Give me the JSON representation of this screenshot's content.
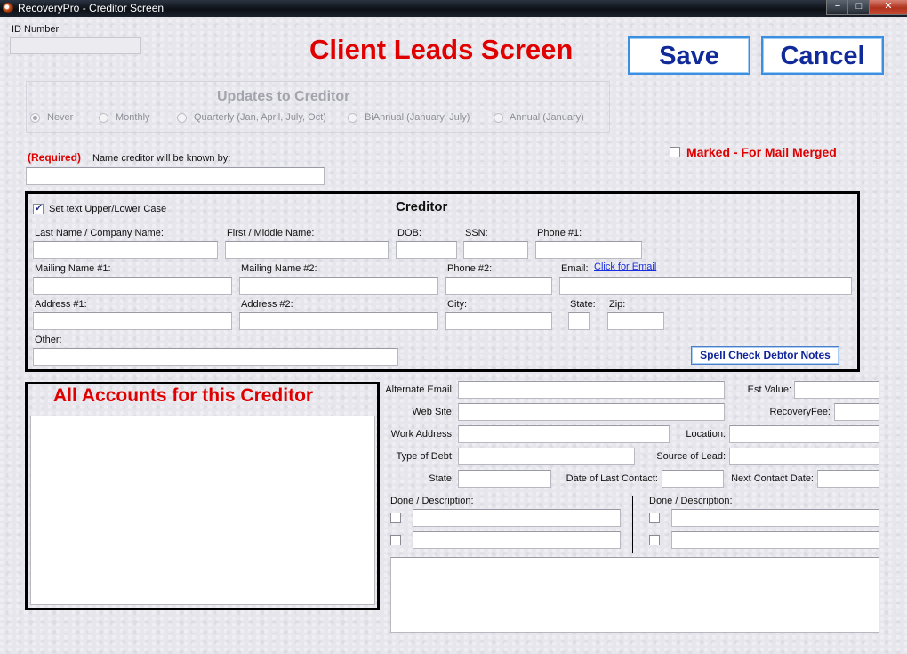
{
  "window": {
    "title": "RecoveryPro - Creditor Screen",
    "minimize": "−",
    "maximize": "□",
    "close": "✕"
  },
  "header": {
    "id_label": "ID Number",
    "screen_title": "Client Leads Screen",
    "save_label": "Save",
    "cancel_label": "Cancel"
  },
  "updates": {
    "title": "Updates to Creditor",
    "options": [
      "Never",
      "Monthly",
      "Quarterly (Jan, April, July, Oct)",
      "BiAnnual (January, July)",
      "Annual (January)"
    ],
    "selected": "Never"
  },
  "required_label": "(Required)",
  "known_by_label": "Name creditor will be known by:",
  "marked_label": "Marked - For Mail Merged",
  "creditor": {
    "title": "Creditor",
    "case_label": "Set text Upper/Lower Case",
    "last_name": "Last Name / Company Name:",
    "first_name": "First / Middle Name:",
    "dob": "DOB:",
    "ssn": "SSN:",
    "phone1": "Phone #1:",
    "mailing1": "Mailing Name #1:",
    "mailing2": "Mailing Name #2:",
    "phone2": "Phone #2:",
    "email": "Email:",
    "email_link": "Click for Email",
    "address1": "Address #1:",
    "address2": "Address #2:",
    "city": "City:",
    "state": "State:",
    "zip": "Zip:",
    "other": "Other:",
    "spell_check": "Spell Check Debtor Notes"
  },
  "accounts": {
    "title": "All Accounts for this Creditor"
  },
  "details": {
    "alt_email": "Alternate Email:",
    "est_value": "Est Value:",
    "web_site": "Web Site:",
    "recovery_fee": "RecoveryFee:",
    "work_address": "Work Address:",
    "location": "Location:",
    "type_of_debt": "Type of Debt:",
    "source_of_lead": "Source of Lead:",
    "state": "State:",
    "date_last_contact": "Date of Last Contact:",
    "next_contact": "Next Contact Date:",
    "done_desc_left": "Done  /  Description:",
    "done_desc_right": "Done  /  Description:"
  }
}
